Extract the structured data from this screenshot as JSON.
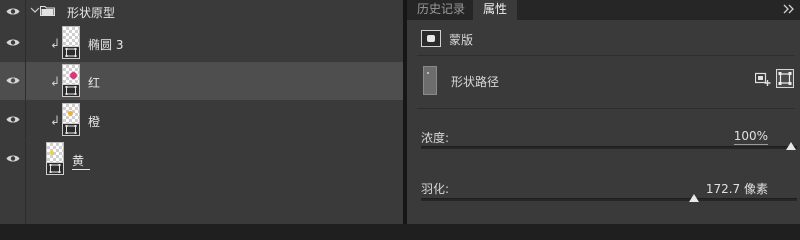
{
  "layers_panel": {
    "group": {
      "name": "形状原型",
      "expanded": true
    },
    "layers": [
      {
        "name": "椭圆 3",
        "clipped": true,
        "selected": false,
        "thumb_dot": ""
      },
      {
        "name": "红",
        "clipped": true,
        "selected": true,
        "thumb_dot": "#e0357a"
      },
      {
        "name": "橙",
        "clipped": true,
        "selected": false,
        "thumb_dot": "#f0b030"
      },
      {
        "name": "黄",
        "clipped": false,
        "selected": false,
        "thumb_dot": "#f0d030"
      }
    ],
    "icons": {
      "visibility": "eye-icon",
      "group": "folder-icon",
      "clip": "clipping-arrow-icon",
      "mask": "vector-mask-icon"
    }
  },
  "properties_panel": {
    "tabs": [
      {
        "label": "历史记录",
        "active": false
      },
      {
        "label": "属性",
        "active": true
      }
    ],
    "collapse_icon": "double-chevron-right-icon",
    "mask_type": {
      "label": "蒙版",
      "icon": "vector-mask-icon"
    },
    "shape_path": {
      "label": "形状路径",
      "add_mask_icon": "add-pixel-mask-icon",
      "select_mask_icon": "select-vector-mask-icon"
    },
    "density": {
      "label": "浓度:",
      "value": "100%",
      "fraction": 1.0
    },
    "feather": {
      "label": "羽化:",
      "value": "172.7 像素",
      "fraction": 0.726
    }
  },
  "colors": {
    "panel_bg": "#3a3a3a",
    "selected_row": "#4e4e4e",
    "red_dot": "#e0357a"
  }
}
